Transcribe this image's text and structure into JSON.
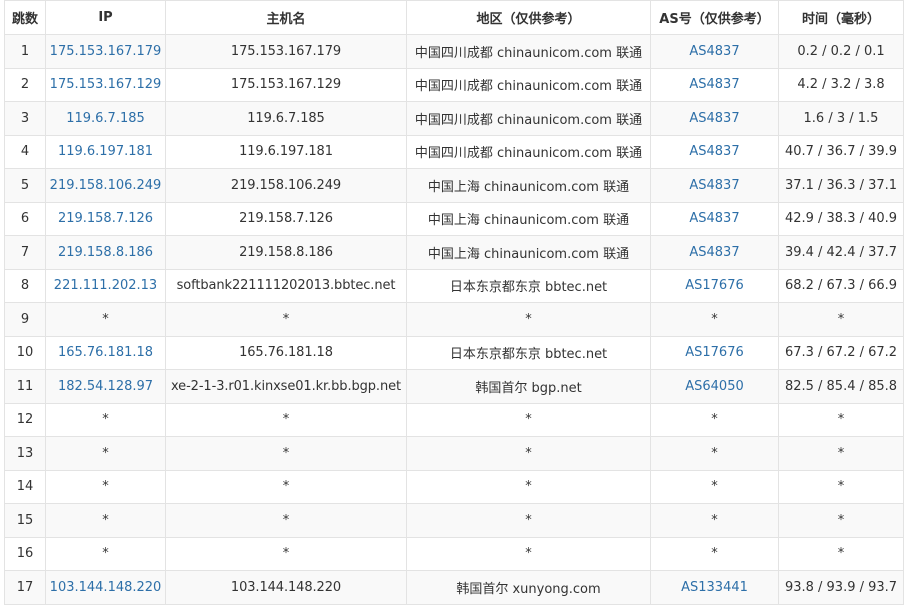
{
  "colors": {
    "link": "#2d6fa8",
    "text": "#333333",
    "border": "#e3e3e3",
    "row_alt": "#f9f9f9"
  },
  "table": {
    "headers": {
      "hop": "跳数",
      "ip": "IP",
      "host": "主机名",
      "region": "地区（仅供参考）",
      "asn": "AS号（仅供参考）",
      "time": "时间（毫秒）"
    },
    "rows": [
      {
        "hop": "1",
        "ip": "175.153.167.179",
        "host": "175.153.167.179",
        "region": "中国四川成都 chinaunicom.com 联通",
        "asn": "AS4837",
        "time": "0.2 / 0.2 / 0.1"
      },
      {
        "hop": "2",
        "ip": "175.153.167.129",
        "host": "175.153.167.129",
        "region": "中国四川成都 chinaunicom.com 联通",
        "asn": "AS4837",
        "time": "4.2 / 3.2 / 3.8"
      },
      {
        "hop": "3",
        "ip": "119.6.7.185",
        "host": "119.6.7.185",
        "region": "中国四川成都 chinaunicom.com 联通",
        "asn": "AS4837",
        "time": "1.6 / 3 / 1.5"
      },
      {
        "hop": "4",
        "ip": "119.6.197.181",
        "host": "119.6.197.181",
        "region": "中国四川成都 chinaunicom.com 联通",
        "asn": "AS4837",
        "time": "40.7 / 36.7 / 39.9"
      },
      {
        "hop": "5",
        "ip": "219.158.106.249",
        "host": "219.158.106.249",
        "region": "中国上海 chinaunicom.com 联通",
        "asn": "AS4837",
        "time": "37.1 / 36.3 / 37.1"
      },
      {
        "hop": "6",
        "ip": "219.158.7.126",
        "host": "219.158.7.126",
        "region": "中国上海 chinaunicom.com 联通",
        "asn": "AS4837",
        "time": "42.9 / 38.3 / 40.9"
      },
      {
        "hop": "7",
        "ip": "219.158.8.186",
        "host": "219.158.8.186",
        "region": "中国上海 chinaunicom.com 联通",
        "asn": "AS4837",
        "time": "39.4 / 42.4 / 37.7"
      },
      {
        "hop": "8",
        "ip": "221.111.202.13",
        "host": "softbank221111202013.bbtec.net",
        "region": "日本东京都东京 bbtec.net",
        "asn": "AS17676",
        "time": "68.2 / 67.3 / 66.9"
      },
      {
        "hop": "9",
        "ip": "*",
        "host": "*",
        "region": "*",
        "asn": "*",
        "time": "*"
      },
      {
        "hop": "10",
        "ip": "165.76.181.18",
        "host": "165.76.181.18",
        "region": "日本东京都东京 bbtec.net",
        "asn": "AS17676",
        "time": "67.3 / 67.2 / 67.2"
      },
      {
        "hop": "11",
        "ip": "182.54.128.97",
        "host": "xe-2-1-3.r01.kinxse01.kr.bb.bgp.net",
        "region": "韩国首尔 bgp.net",
        "asn": "AS64050",
        "time": "82.5 / 85.4 / 85.8"
      },
      {
        "hop": "12",
        "ip": "*",
        "host": "*",
        "region": "*",
        "asn": "*",
        "time": "*"
      },
      {
        "hop": "13",
        "ip": "*",
        "host": "*",
        "region": "*",
        "asn": "*",
        "time": "*"
      },
      {
        "hop": "14",
        "ip": "*",
        "host": "*",
        "region": "*",
        "asn": "*",
        "time": "*"
      },
      {
        "hop": "15",
        "ip": "*",
        "host": "*",
        "region": "*",
        "asn": "*",
        "time": "*"
      },
      {
        "hop": "16",
        "ip": "*",
        "host": "*",
        "region": "*",
        "asn": "*",
        "time": "*"
      },
      {
        "hop": "17",
        "ip": "103.144.148.220",
        "host": "103.144.148.220",
        "region": "韩国首尔 xunyong.com",
        "asn": "AS133441",
        "time": "93.8 / 93.9 / 93.7"
      }
    ]
  }
}
